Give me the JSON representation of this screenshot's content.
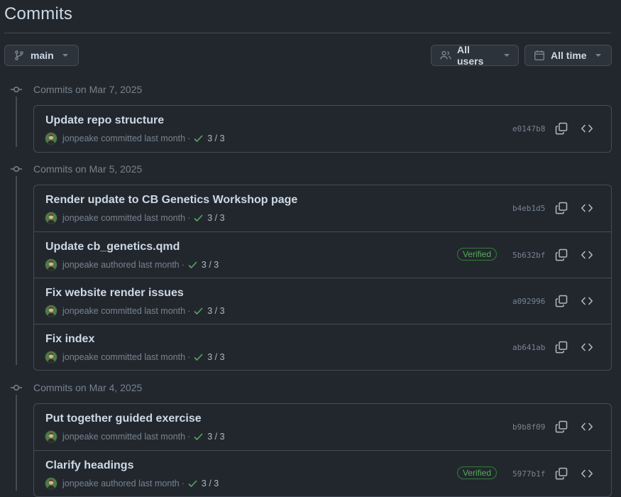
{
  "page": {
    "title": "Commits"
  },
  "filters": {
    "branch": "main",
    "users": "All users",
    "time": "All time"
  },
  "groups": [
    {
      "header": "Commits on Mar 7, 2025",
      "commits": [
        {
          "message": "Update repo structure",
          "author": "jonpeake",
          "action": "committed",
          "when": "last month",
          "checks": "3 / 3",
          "sha": "e0147b8",
          "verified": ""
        }
      ]
    },
    {
      "header": "Commits on Mar 5, 2025",
      "commits": [
        {
          "message": "Render update to CB Genetics Workshop page",
          "author": "jonpeake",
          "action": "committed",
          "when": "last month",
          "checks": "3 / 3",
          "sha": "b4eb1d5",
          "verified": ""
        },
        {
          "message": "Update cb_genetics.qmd",
          "author": "jonpeake",
          "action": "authored",
          "when": "last month",
          "checks": "3 / 3",
          "sha": "5b632bf",
          "verified": "Verified"
        },
        {
          "message": "Fix website render issues",
          "author": "jonpeake",
          "action": "committed",
          "when": "last month",
          "checks": "3 / 3",
          "sha": "a092996",
          "verified": ""
        },
        {
          "message": "Fix index",
          "author": "jonpeake",
          "action": "committed",
          "when": "last month",
          "checks": "3 / 3",
          "sha": "ab641ab",
          "verified": ""
        }
      ]
    },
    {
      "header": "Commits on Mar 4, 2025",
      "commits": [
        {
          "message": "Put together guided exercise",
          "author": "jonpeake",
          "action": "committed",
          "when": "last month",
          "checks": "3 / 3",
          "sha": "b9b8f09",
          "verified": ""
        },
        {
          "message": "Clarify headings",
          "author": "jonpeake",
          "action": "authored",
          "when": "last month",
          "checks": "3 / 3",
          "sha": "5977b1f",
          "verified": "Verified"
        }
      ]
    }
  ]
}
